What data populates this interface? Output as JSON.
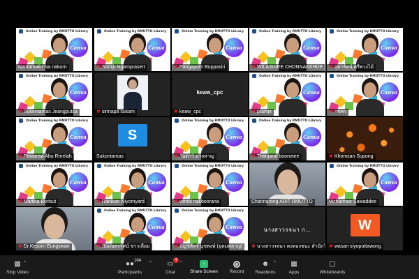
{
  "slide_header": "Online Training by RMUTTO Library",
  "slide_brand": "Canva",
  "tiles": [
    {
      "kind": "slide",
      "name": "Nantamalin Na nakorn",
      "muted": false
    },
    {
      "kind": "slide",
      "name": "Somjit Ngamprasert",
      "muted": true
    },
    {
      "kind": "slide",
      "name": "Pangaporn Buppasiri",
      "muted": true
    },
    {
      "kind": "slide",
      "name": "WILASINEE CHONNAKKHUE",
      "muted": true
    },
    {
      "kind": "slide",
      "name": "สุดารัตน์ ศรีพวงไม้",
      "muted": true
    },
    {
      "kind": "slide",
      "name": "Sukontamas Jeangputsa",
      "muted": true
    },
    {
      "kind": "photo",
      "name": "sirinapa sukam",
      "muted": true
    },
    {
      "kind": "text",
      "name": "keaw_cpc",
      "label": "keaw_cpc",
      "muted": true
    },
    {
      "kind": "slide",
      "name": "pramjit",
      "muted": true
    },
    {
      "kind": "slide",
      "name": "กชพร",
      "muted": true
    },
    {
      "kind": "slide",
      "name": "Pawarisa Abu Rmelah",
      "muted": true
    },
    {
      "kind": "avatar",
      "name": "Sukontamas",
      "letter": "S",
      "color": "#1e8ce0",
      "muted": false
    },
    {
      "kind": "slide",
      "name": "วันดาวิ อาจหาญ",
      "muted": true
    },
    {
      "kind": "slide",
      "name": "Thanjarat boonmee",
      "muted": true
    },
    {
      "kind": "flowers",
      "name": "Khomsan Supong",
      "muted": true
    },
    {
      "kind": "slide",
      "name": "Mattika Borisut",
      "muted": true
    },
    {
      "kind": "slide",
      "name": "Ranikan Niyomyard",
      "muted": true
    },
    {
      "kind": "slide",
      "name": "wimol nakboorana",
      "muted": true
    },
    {
      "kind": "face",
      "name": "Channarong ARIT RMUTTO",
      "muted": false
    },
    {
      "kind": "slide",
      "name": "Vicharinee Sawaddee",
      "muted": false,
      "active": true
    },
    {
      "kind": "face",
      "name": "Dr.Kesorn Eungswan",
      "muted": true
    },
    {
      "kind": "slide",
      "name": "ปัณณทรรศน์ ชาวเลือม",
      "muted": true
    },
    {
      "kind": "slide",
      "name": "อัญชลีทร์ นุชพงษ์ (อุดมพลาญ)",
      "muted": true
    },
    {
      "kind": "text",
      "name": "นางสาวรจนา คงทองชนะ สำนักวิทยบริการฯ",
      "label": "นางสาวรจนา ก...",
      "muted": true
    },
    {
      "kind": "avatar",
      "name": "wasan siyoputtawong",
      "letter": "W",
      "color": "#f15a22",
      "muted": true
    }
  ],
  "toolbar": {
    "stop_video": "Stop Video",
    "participants": "Participants",
    "participants_count": "104",
    "chat": "Chat",
    "chat_badge": "4",
    "share_screen": "Share Screen",
    "record": "Record",
    "reactions": "Reactions",
    "apps": "Apps",
    "whiteboards": "Whiteboards"
  }
}
